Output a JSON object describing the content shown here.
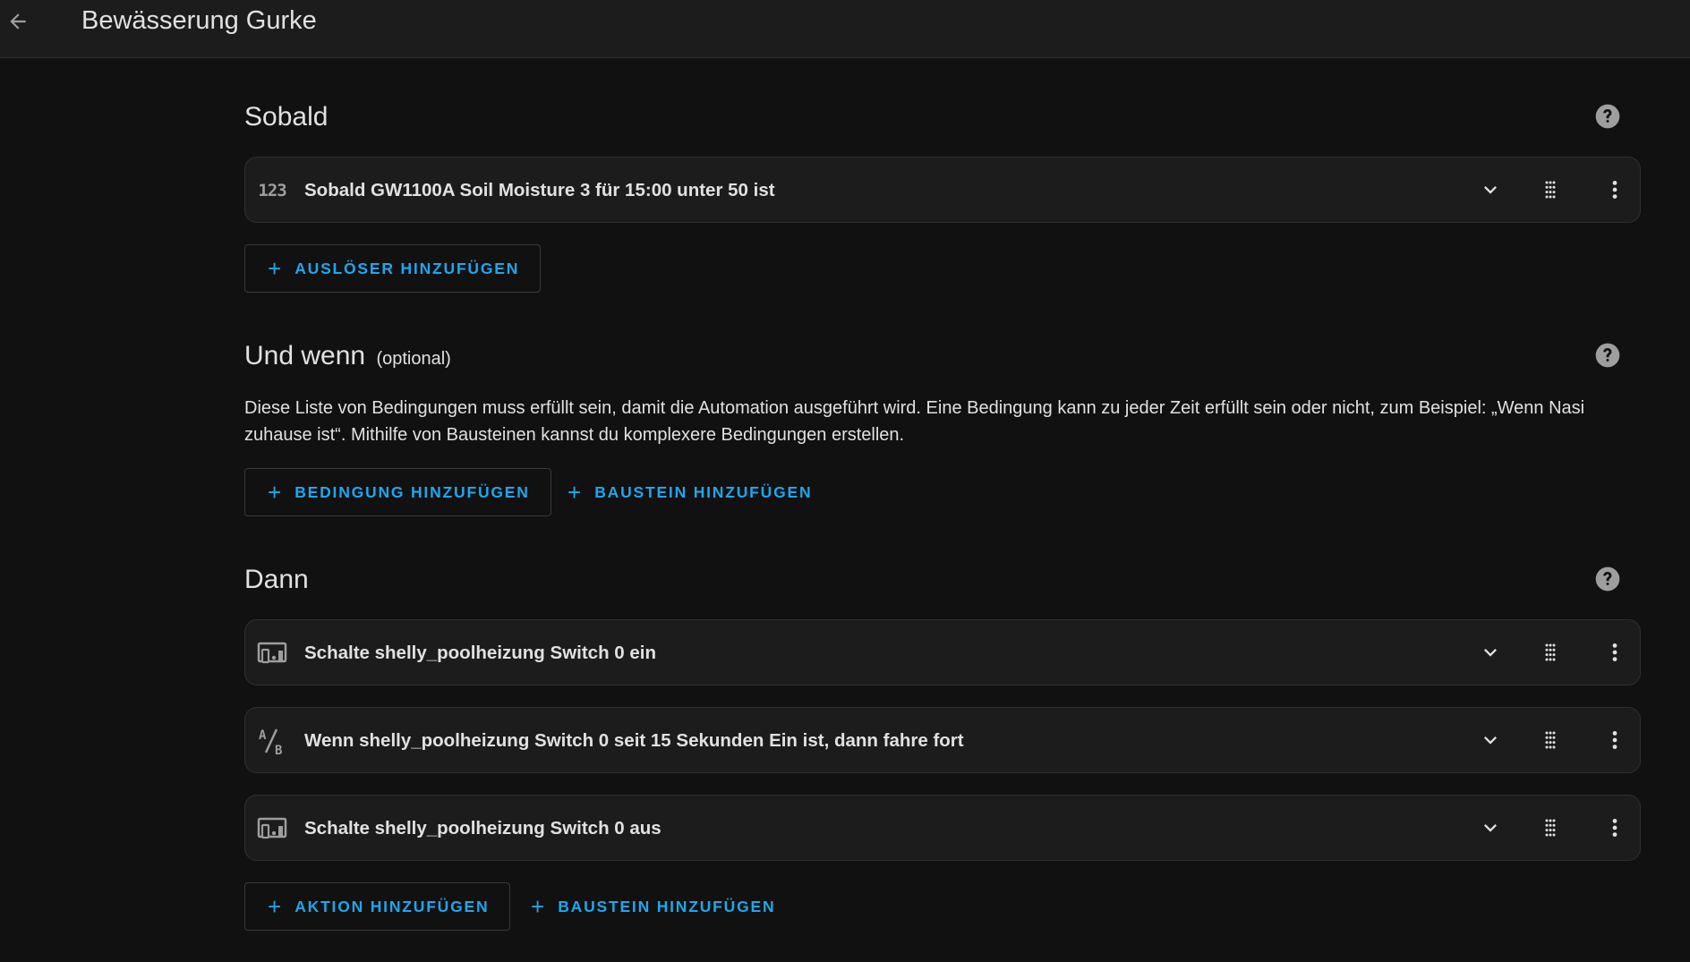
{
  "header": {
    "title": "Bewässerung Gurke",
    "back_icon": "arrow-left-icon"
  },
  "triggers": {
    "title": "Sobald",
    "items": [
      {
        "icon": "numeric-icon",
        "icon_text": "123",
        "text": "Sobald GW1100A Soil Moisture 3 für 15:00 unter 50 ist"
      }
    ],
    "add_label": "AUSLÖSER HINZUFÜGEN"
  },
  "conditions": {
    "title": "Und wenn",
    "optional_label": "(optional)",
    "description": "Diese Liste von Bedingungen muss erfüllt sein, damit die Automation ausgeführt wird. Eine Bedingung kann zu jeder Zeit erfüllt sein oder nicht, zum Beispiel: „Wenn Nasi zuhause ist“. Mithilfe von Bausteinen kannst du komplexere Bedingungen erstellen.",
    "add_label": "BEDINGUNG HINZUFÜGEN",
    "add_block_label": "BAUSTEIN HINZUFÜGEN"
  },
  "actions": {
    "title": "Dann",
    "items": [
      {
        "icon": "devices-icon",
        "text": "Schalte shelly_poolheizung Switch 0 ein"
      },
      {
        "icon": "ab-testing-icon",
        "icon_text": "A/B",
        "text": "Wenn shelly_poolheizung Switch 0 seit 15 Sekunden Ein ist, dann fahre fort"
      },
      {
        "icon": "devices-icon",
        "text": "Schalte shelly_poolheizung Switch 0 aus"
      }
    ],
    "add_label": "AKTION HINZUFÜGEN",
    "add_block_label": "BAUSTEIN HINZUFÜGEN"
  },
  "colors": {
    "accent": "#1ea7ee",
    "background": "#111111",
    "card": "#1c1c1c",
    "text": "#e1e1e1"
  }
}
